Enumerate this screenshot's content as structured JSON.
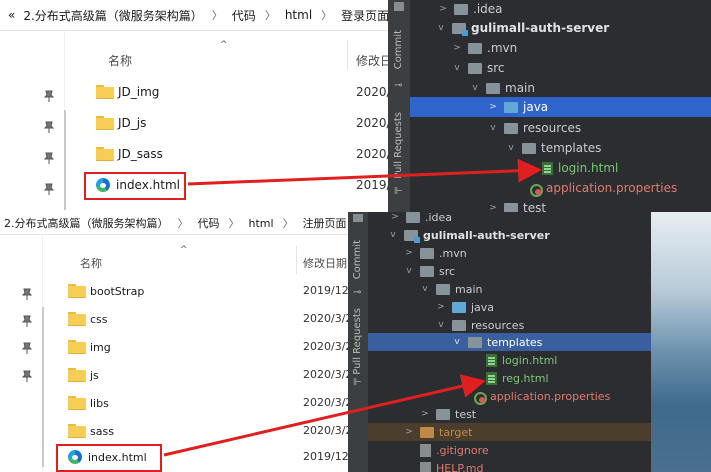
{
  "top_explorer": {
    "breadcrumb": [
      "«",
      "2.分布式高级篇（微服务架构篇）",
      "代码",
      "html",
      "登录页面"
    ],
    "col_name": "名称",
    "col_date": "修改日",
    "rows": [
      {
        "name": "JD_img",
        "date": "2020/"
      },
      {
        "name": "JD_js",
        "date": "2020/"
      },
      {
        "name": "JD_sass",
        "date": "2020/"
      },
      {
        "name": "index.html",
        "date": "2019/"
      }
    ]
  },
  "top_ide": {
    "strip_labels": [
      "Commit",
      "Pull Requests"
    ],
    "tree": [
      {
        "label": ".idea"
      },
      {
        "label": "gulimall-auth-server"
      },
      {
        "label": ".mvn"
      },
      {
        "label": "src"
      },
      {
        "label": "main"
      },
      {
        "label": "java"
      },
      {
        "label": "resources"
      },
      {
        "label": "templates"
      },
      {
        "label": "login.html"
      },
      {
        "label": "application.properties"
      },
      {
        "label": "test"
      }
    ]
  },
  "bottom_explorer": {
    "breadcrumb": [
      "2.分布式高级篇（微服务架构篇）",
      "代码",
      "html",
      "注册页面"
    ],
    "col_name": "名称",
    "col_date": "修改日期",
    "rows": [
      {
        "name": "bootStrap",
        "date": "2019/12"
      },
      {
        "name": "css",
        "date": "2020/3/2"
      },
      {
        "name": "img",
        "date": "2020/3/2"
      },
      {
        "name": "js",
        "date": "2020/3/2"
      },
      {
        "name": "libs",
        "date": "2020/3/2"
      },
      {
        "name": "sass",
        "date": "2020/3/2"
      },
      {
        "name": "index.html",
        "date": "2019/12"
      }
    ]
  },
  "bottom_ide": {
    "strip_labels": [
      "Commit",
      "Pull Requests"
    ],
    "tree": [
      {
        "label": ".idea"
      },
      {
        "label": "gulimall-auth-server"
      },
      {
        "label": ".mvn"
      },
      {
        "label": "src"
      },
      {
        "label": "main"
      },
      {
        "label": "java"
      },
      {
        "label": "resources"
      },
      {
        "label": "templates"
      },
      {
        "label": "login.html"
      },
      {
        "label": "reg.html"
      },
      {
        "label": "application.properties"
      },
      {
        "label": "test"
      },
      {
        "label": "target"
      },
      {
        "label": ".gitignore"
      },
      {
        "label": "HELP.md"
      }
    ]
  },
  "colors": {
    "arrow": "#e02020",
    "ide_bg": "#2b2d30",
    "selection": "#2f65ca"
  }
}
